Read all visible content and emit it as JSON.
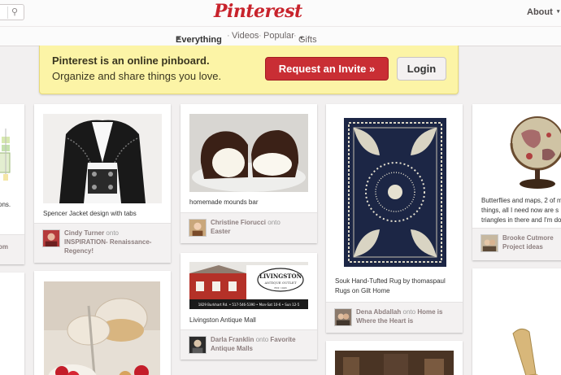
{
  "header": {
    "logo": "Pinterest",
    "about": "About",
    "caret": "▾",
    "search_icon_glyph": "⚲"
  },
  "nav": {
    "everything": "Everything",
    "videos": "Videos",
    "popular": "Popular",
    "gifts": "Gifts",
    "separator": "·"
  },
  "banner": {
    "line1": "Pinterest is an online pinboard.",
    "line2": "Organize and share things you love.",
    "invite_label": "Request an Invite »",
    "login_label": "Login"
  },
  "pins": {
    "left_edge_1": {
      "desc_line1": "ons.",
      "attr": "om"
    },
    "spencer": {
      "desc": "Spencer Jacket design with tabs",
      "user": "Cindy Turner",
      "onto": "onto",
      "board": "INSPIRATION- Renaissance-Regency!"
    },
    "mounds": {
      "desc": "homemade mounds bar",
      "user": "Christine Fiorucci",
      "onto": "onto",
      "board": "Easter"
    },
    "antique": {
      "desc": "Livingston Antique Mall",
      "sign_name": "LIVINGSTON",
      "sign_sub": "ANTIQUE OUTLET",
      "sign_est": "EST. 1993",
      "sign_bar": "1829 Burkhart Rd. • 517-546-5390 • Mon-Sat 10-6 • Sun 12-5",
      "user": "Darla Franklin",
      "onto": "onto",
      "board": "Favorite Antique Malls"
    },
    "souk": {
      "desc": "Souk Hand-Tufted Rug by thomaspaul Rugs on Gilt Home",
      "user": "Dena Abdallah",
      "onto": "onto",
      "board": "Home is Where the Heart is"
    },
    "globe": {
      "desc_line1": "Butterflies and maps, 2 of m",
      "desc_line2": "things, all I need now are s",
      "desc_line3": "triangles in there and I'm do",
      "user": "Brooke Cutmore",
      "board": "Project ideas"
    }
  },
  "colors": {
    "brand_red": "#c8232c",
    "banner_yellow": "#fcf4a6",
    "invite_red": "#c92e34",
    "page_bg": "#f2f0f0"
  }
}
